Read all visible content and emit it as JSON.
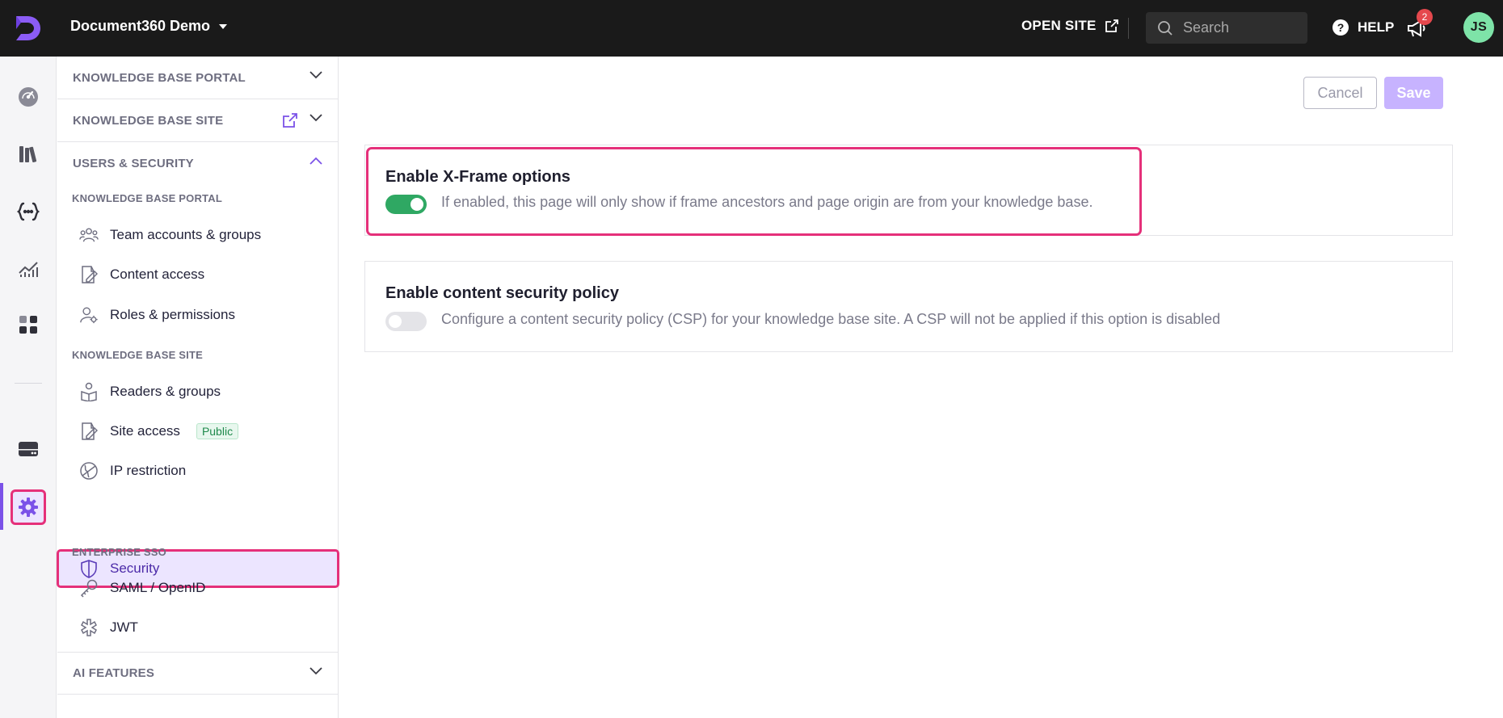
{
  "header": {
    "project_name": "Document360 Demo",
    "open_site_label": "OPEN SITE",
    "search_placeholder": "Search",
    "help_label": "HELP",
    "notification_count": "2",
    "user_initials": "JS"
  },
  "colors": {
    "accent": "#7b52e8",
    "highlight": "#e5307a",
    "toggle_on": "#2fa863"
  },
  "rail": {
    "items": [
      "dashboard-icon",
      "documentation-icon",
      "api-docs-icon",
      "analytics-icon",
      "widgets-icon",
      "drive-icon",
      "settings-icon"
    ]
  },
  "nav": {
    "kb_portal_header": "KNOWLEDGE BASE PORTAL",
    "kb_site_header": "KNOWLEDGE BASE SITE",
    "users_security_header": "USERS & SECURITY",
    "sub_kb_portal": "KNOWLEDGE BASE PORTAL",
    "team_accounts": "Team accounts & groups",
    "content_access": "Content access",
    "roles_permissions": "Roles & permissions",
    "sub_kb_site": "KNOWLEDGE BASE SITE",
    "readers_groups": "Readers & groups",
    "site_access": "Site access",
    "site_access_badge": "Public",
    "ip_restriction": "IP restriction",
    "security": "Security",
    "sub_enterprise_sso": "ENTERPRISE SSO",
    "saml_openid": "SAML / OpenID",
    "jwt": "JWT",
    "ai_features_header": "AI FEATURES"
  },
  "actions": {
    "cancel_label": "Cancel",
    "save_label": "Save"
  },
  "options": {
    "xframe": {
      "title": "Enable X-Frame options",
      "description": "If enabled, this page will only show if frame ancestors and page origin are from your knowledge base.",
      "enabled": true
    },
    "csp": {
      "title": "Enable content security policy",
      "description": "Configure a content security policy (CSP) for your knowledge base site. A CSP will not be applied if this option is disabled",
      "enabled": false
    }
  }
}
